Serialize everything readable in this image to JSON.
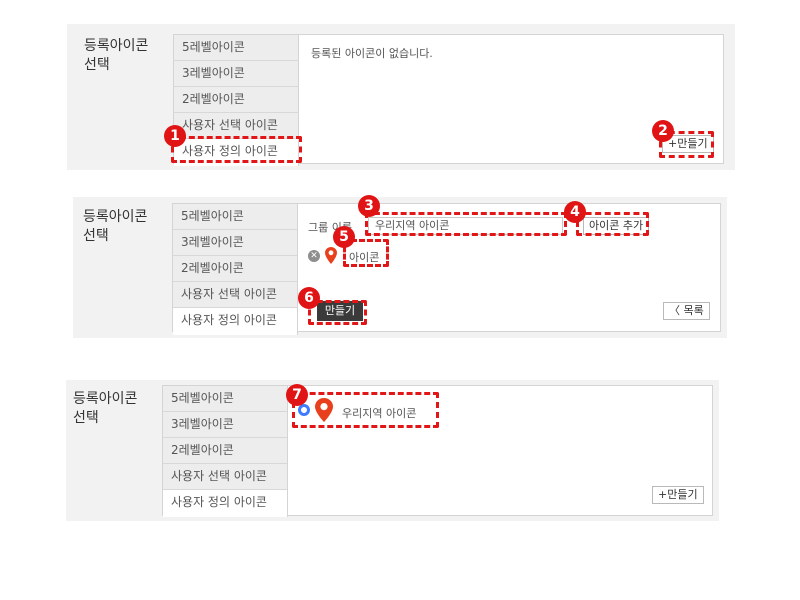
{
  "section_label": "등록아이콘\n선택",
  "menu_items": [
    "5레벨아이콘",
    "3레벨아이콘",
    "2레벨아이콘",
    "사용자 선택 아이콘",
    "사용자 정의 아이콘"
  ],
  "panel1": {
    "empty_message": "등록된 아이콘이 없습니다.",
    "make_button": "+만들기"
  },
  "panel2": {
    "group_name_label": "그룹 이름",
    "group_name_value": "우리지역 아이콘",
    "add_icon_button": "아이콘 추가",
    "icon_item_label": "아이콘",
    "make_button": "만들기",
    "list_button": "〈 목록"
  },
  "panel3": {
    "icon_group_label": "우리지역 아이콘",
    "make_button": "+만들기"
  },
  "badges": [
    "1",
    "2",
    "3",
    "4",
    "5",
    "6",
    "7"
  ],
  "colors": {
    "highlight": "#e21616",
    "badge": "#e01414",
    "pin": "#e8401c",
    "radio": "#3d7cff"
  }
}
